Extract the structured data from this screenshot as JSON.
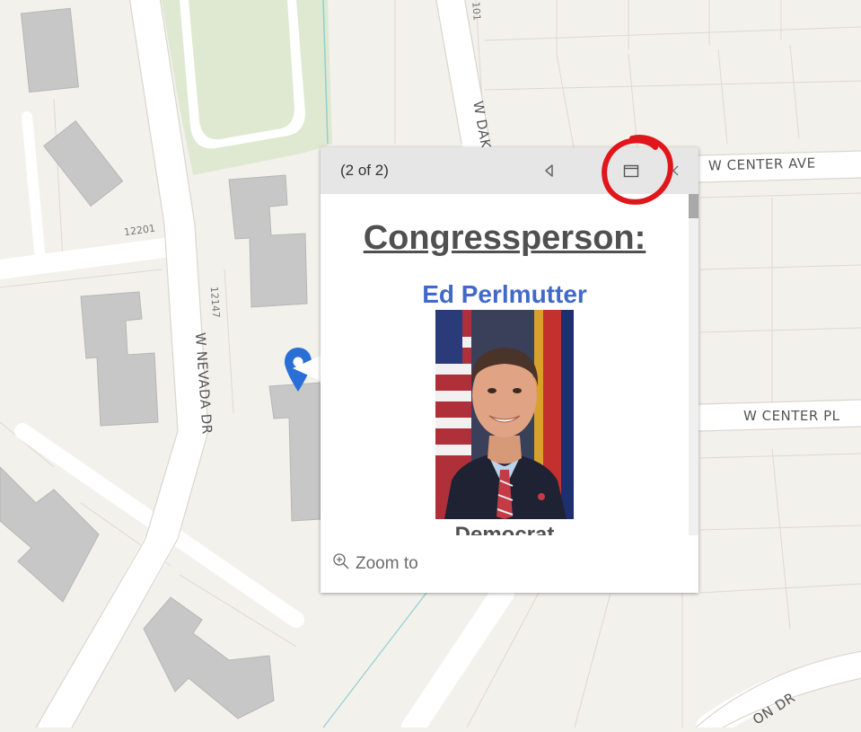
{
  "map": {
    "streets": {
      "center_ave": "W CENTER AVE",
      "center_pl": "W CENTER PL",
      "nevada_dr": "W NEVADA DR",
      "dakota": "W DAK",
      "bottom_dr": "ON DR"
    },
    "addresses": {
      "a12201": "12201",
      "a12147": "12147",
      "a101": "101"
    },
    "colors": {
      "background": "#f3f1ec",
      "park": "#dfe9d2",
      "building": "#c4c4c4",
      "road": "#ffffff"
    }
  },
  "popup": {
    "pager_text": "(2 of 2)",
    "previous_icon": "triangle-left-icon",
    "dock_icon": "dock-window-icon",
    "close_icon": "close-icon",
    "title": "Congressperson:",
    "name": "Ed Perlmutter",
    "party": "Democrat",
    "zoom_label": "Zoom to",
    "zoom_icon": "zoom-in-icon",
    "title_color": "#505050",
    "name_color": "#4169c8"
  },
  "marker": {
    "icon": "map-pin-icon",
    "color": "#2a6fd6"
  },
  "annotation": {
    "color": "#e0161b"
  }
}
